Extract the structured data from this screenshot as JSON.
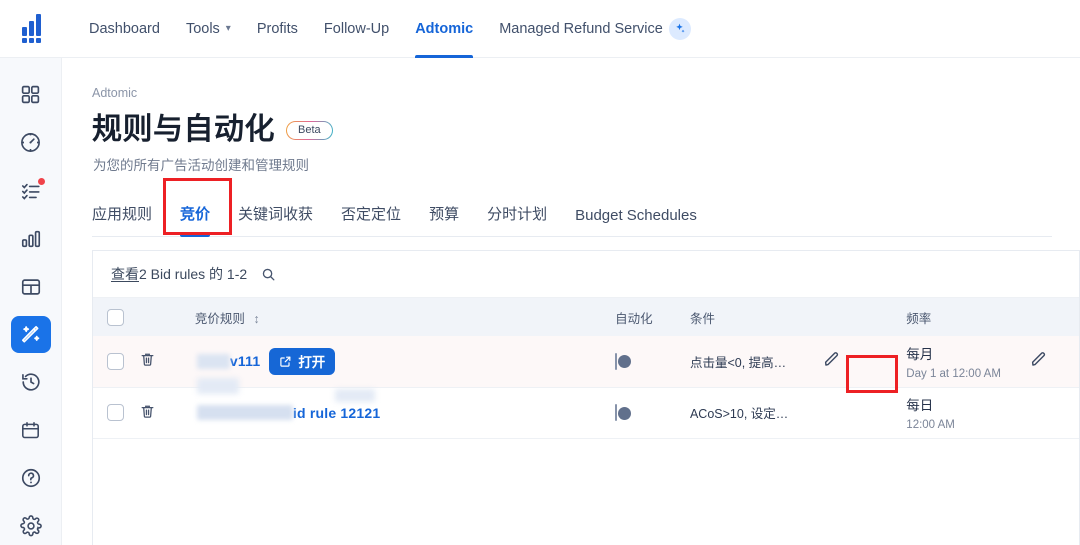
{
  "topnav": {
    "logo": "helium-logo",
    "items": [
      {
        "label": "Dashboard",
        "active": false,
        "caret": false
      },
      {
        "label": "Tools",
        "active": false,
        "caret": true
      },
      {
        "label": "Profits",
        "active": false,
        "caret": false
      },
      {
        "label": "Follow-Up",
        "active": false,
        "caret": false
      },
      {
        "label": "Adtomic",
        "active": true,
        "caret": false
      },
      {
        "label": "Managed Refund Service",
        "active": false,
        "caret": false
      }
    ],
    "badge_icon": "sparkle-icon"
  },
  "sidebar": {
    "items": [
      {
        "icon": "grid-apps-icon",
        "active": false,
        "dot": false
      },
      {
        "icon": "speedometer-icon",
        "active": false,
        "dot": false
      },
      {
        "icon": "checklist-icon",
        "active": false,
        "dot": true
      },
      {
        "icon": "bar-chart-icon",
        "active": false,
        "dot": false
      },
      {
        "icon": "table-icon",
        "active": false,
        "dot": false
      },
      {
        "icon": "magic-wand-icon",
        "active": true,
        "dot": false
      },
      {
        "icon": "history-icon",
        "active": false,
        "dot": false
      },
      {
        "icon": "calendar-icon",
        "active": false,
        "dot": false
      },
      {
        "icon": "help-circle-icon",
        "active": false,
        "dot": false
      },
      {
        "icon": "gear-icon",
        "active": false,
        "dot": false
      }
    ]
  },
  "page": {
    "breadcrumb": "Adtomic",
    "title": "规则与自动化",
    "beta_badge": "Beta",
    "subtitle": "为您的所有广告活动创建和管理规则"
  },
  "tabs": [
    {
      "label": "应用规则",
      "active": false
    },
    {
      "label": "竞价",
      "active": true
    },
    {
      "label": "关键词收获",
      "active": false
    },
    {
      "label": "否定定位",
      "active": false
    },
    {
      "label": "预算",
      "active": false
    },
    {
      "label": "分时计划",
      "active": false
    },
    {
      "label": "Budget Schedules",
      "active": false
    }
  ],
  "filterbar": {
    "prefix": "查看",
    "text": " 2 Bid rules 的 1-2",
    "search_icon": "search-icon"
  },
  "table": {
    "headers": {
      "select": "",
      "delete": "",
      "name": "竞价规则",
      "automation": "自动化",
      "condition": "条件",
      "edit": "",
      "frequency": "频率"
    },
    "rows": [
      {
        "name_masked": true,
        "name": "v111",
        "open_button": "打开",
        "open_icon": "external-link-icon",
        "toggle_on": false,
        "condition": "点击量<0, 提高竞...",
        "edit_icon": "pencil-icon",
        "freq_main": "每月",
        "freq_sub": "Day 1 at 12:00 AM",
        "freq_edit_icon": "pencil-icon",
        "highlighted": true
      },
      {
        "name_masked": true,
        "name": "id rule 12121",
        "open_button": "",
        "toggle_on": false,
        "condition": "ACoS>10, 设定竞...",
        "edit_icon": "",
        "freq_main": "每日",
        "freq_sub": "12:00 AM",
        "freq_edit_icon": "",
        "highlighted": false
      }
    ]
  },
  "annotations": {
    "color": "#ed2024",
    "boxes": [
      {
        "name": "tab-bidding-highlight"
      },
      {
        "name": "row-condition-edit-highlight"
      }
    ]
  }
}
